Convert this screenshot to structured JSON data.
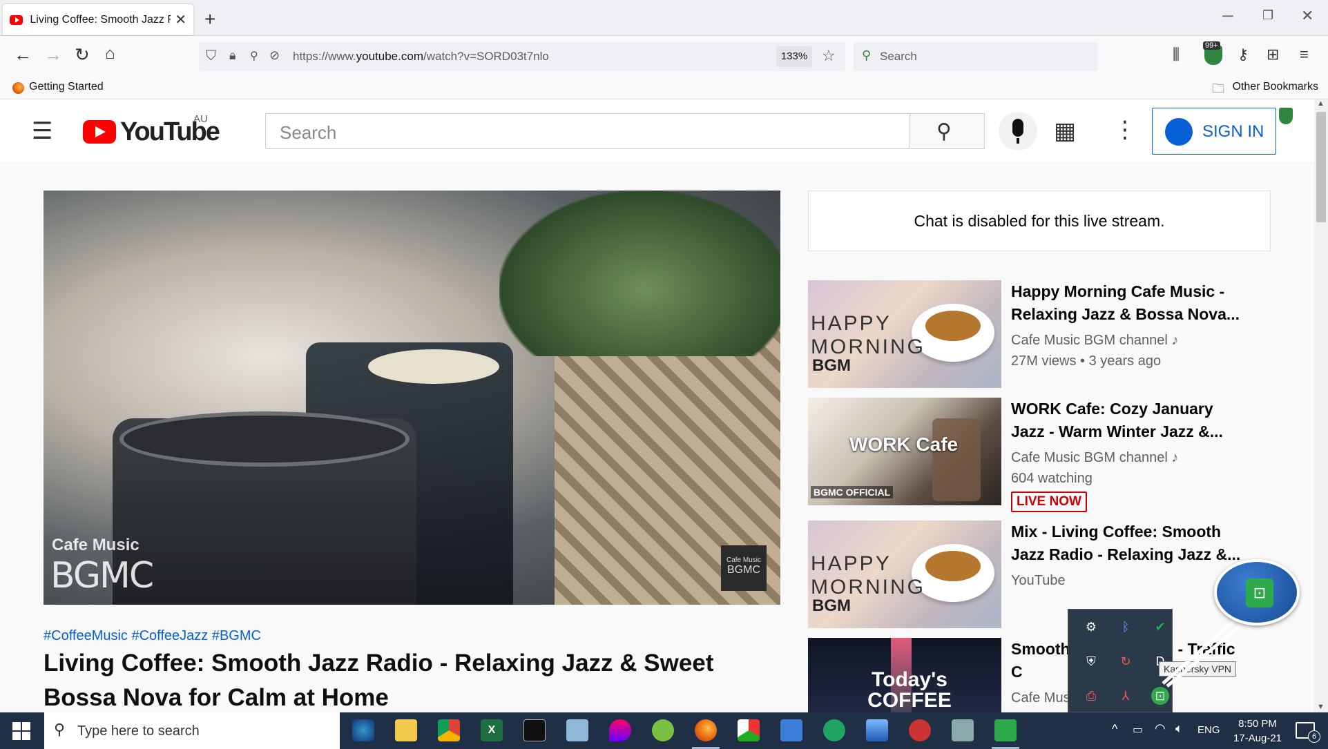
{
  "browser": {
    "tab_title": "Living Coffee: Smooth Jazz Radi",
    "url_prefix": "https://www.",
    "url_domain": "youtube.com",
    "url_path": "/watch?v=SORD03t7nlo",
    "zoom": "133%",
    "search_placeholder": "Search",
    "extension_badge": "99+",
    "bookmarks": {
      "getting_started": "Getting Started",
      "other": "Other Bookmarks"
    }
  },
  "youtube": {
    "logo_text": "YouTube",
    "region": "AU",
    "search_placeholder": "Search",
    "sign_in": "SIGN IN",
    "player": {
      "watermark_top": "Cafe Music",
      "watermark_bottom": "BGMC",
      "corner_logo_top": "Cafe Music",
      "corner_logo_bottom": "BGMC"
    },
    "hashtags": "#CoffeeMusic #CoffeeJazz #BGMC",
    "video_title": "Living Coffee: Smooth Jazz Radio - Relaxing Jazz & Sweet Bossa Nova for Calm at Home",
    "chat_disabled": "Chat is disabled for this live stream.",
    "recommendations": [
      {
        "title": "Happy Morning Cafe Music - Relaxing Jazz & Bossa Nova...",
        "channel": "Cafe Music BGM channel",
        "meta": "27M views • 3 years ago",
        "thumb_text": "HAPPY MORNING",
        "thumb_sub": "BGM"
      },
      {
        "title": "WORK Cafe: Cozy January Jazz - Warm Winter Jazz &...",
        "channel": "Cafe Music BGM channel",
        "meta": "604 watching",
        "badge": "LIVE NOW",
        "thumb_text": "WORK Cafe",
        "thumb_sub": "BGMC OFFICIAL"
      },
      {
        "title": "Mix - Living Coffee: Smooth Jazz Radio - Relaxing Jazz &...",
        "channel": "YouTube",
        "thumb_text": "HAPPY MORNING",
        "thumb_sub": "BGM"
      },
      {
        "title": "Smooth Jazz Hip Hop - Traffic C",
        "channel": "Cafe Mus",
        "thumb_text": "Today's COFFEE"
      }
    ]
  },
  "tray": {
    "vpn_tooltip": "Kaspersky VPN"
  },
  "taskbar": {
    "search_placeholder": "Type here to search",
    "language": "ENG",
    "time": "8:50 PM",
    "date": "17-Aug-21",
    "notification_count": "6"
  },
  "colors": {
    "youtube_red": "#ff0000",
    "link_blue": "#065fd4",
    "live_red": "#cc0000",
    "taskbar": "#1f2f45"
  }
}
